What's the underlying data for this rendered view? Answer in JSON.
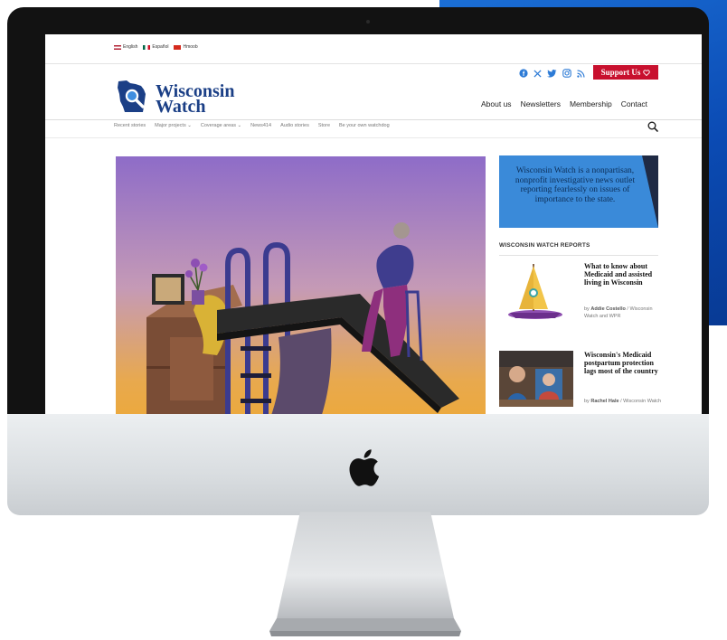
{
  "languages": [
    {
      "label": "English",
      "flag": "us-flag-icon"
    },
    {
      "label": "Español",
      "flag": "mexico-flag-icon"
    },
    {
      "label": "Hmoob",
      "flag": "hmong-flag-icon"
    }
  ],
  "header": {
    "brand_line1": "Wisconsin",
    "brand_line2": "Watch",
    "social_icons": [
      "facebook-icon",
      "x-icon",
      "twitter-icon",
      "instagram-icon",
      "rss-icon"
    ],
    "support_label": "Support Us",
    "nav": [
      "About us",
      "Newsletters",
      "Membership",
      "Contact"
    ]
  },
  "secondary_nav": [
    {
      "label": "Recent stories",
      "dropdown": false
    },
    {
      "label": "Major projects",
      "dropdown": true
    },
    {
      "label": "Coverage areas",
      "dropdown": true
    },
    {
      "label": "News414",
      "dropdown": false
    },
    {
      "label": "Audio stories",
      "dropdown": false
    },
    {
      "label": "Store",
      "dropdown": false
    },
    {
      "label": "Be your own watchdog",
      "dropdown": false
    }
  ],
  "sidebar": {
    "promo_text": "Wisconsin Watch is a nonpartisan, nonprofit investigative news outlet reporting fearlessly on issues of importance to the state.",
    "reports_heading": "WISCONSIN WATCH REPORTS",
    "stories": [
      {
        "title": "What to know about Medicaid and assisted living in Wisconsin",
        "by_prefix": "by",
        "author": "Addie Costello",
        "outlet": "/ Wisconsin Watch and WPR"
      },
      {
        "title": "Wisconsin's Medicaid postpartum protection lags most of the country",
        "by_prefix": "by",
        "author": "Rachel Hale",
        "outlet": "/ Wisconsin Watch"
      }
    ]
  },
  "colors": {
    "brand_blue": "#1b3f86",
    "support_red": "#c8102e",
    "promo_blue": "#3a8ad9",
    "social_blue": "#2d7bd6"
  }
}
